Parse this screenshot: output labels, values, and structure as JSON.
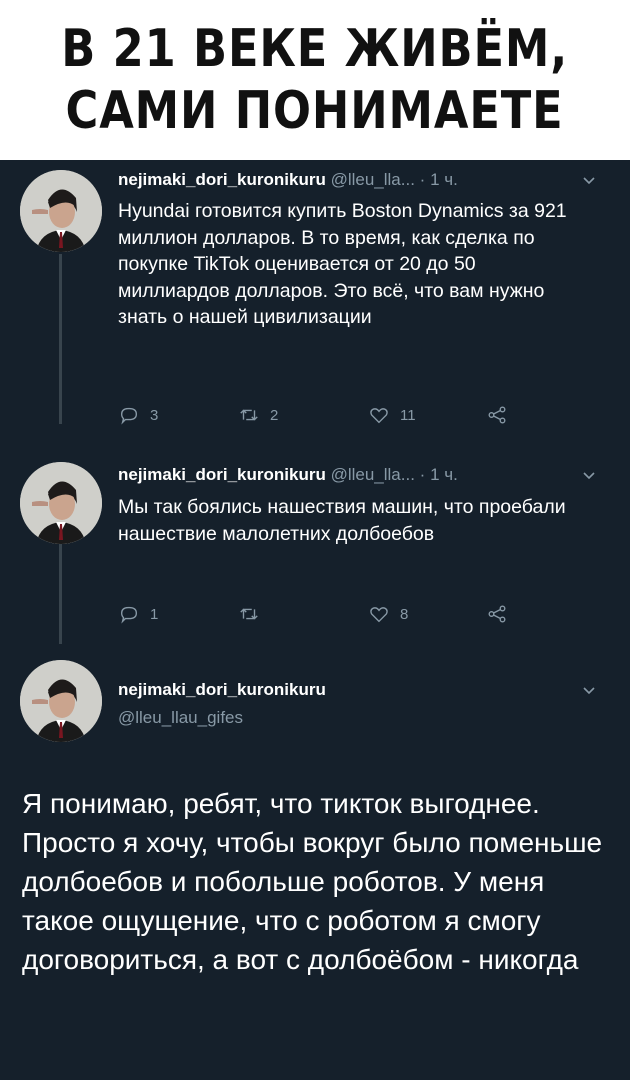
{
  "caption": {
    "line1": "В 21 ВЕКЕ ЖИВЁМ,",
    "line2": "САМИ ПОНИМАЕТЕ"
  },
  "colors": {
    "background": "#15202b",
    "text": "#ffffff",
    "muted": "#8899a6",
    "thread_line": "#38444d",
    "caption_bg": "#ffffff",
    "caption_text": "#111111"
  },
  "tweets": [
    {
      "name": "nejimaki_dori_kuronikuru",
      "handle": "@lleu_lla...",
      "dot": "·",
      "time": "1 ч.",
      "menu_icon": "chevron-down-icon",
      "text": "Hyundai готовится купить Boston Dynamics за 921 миллион долларов. В то время, как сделка по покупке TikTok оценивается от 20 до 50 миллиардов долларов. Это всё, что вам нужно знать о нашей цивилизации",
      "actions": {
        "reply_count": "3",
        "retweet_count": "2",
        "like_count": "11",
        "reply_icon": "reply-icon",
        "retweet_icon": "retweet-icon",
        "like_icon": "heart-icon",
        "share_icon": "share-icon"
      }
    },
    {
      "name": "nejimaki_dori_kuronikuru",
      "handle": "@lleu_lla...",
      "dot": "·",
      "time": "1 ч.",
      "menu_icon": "chevron-down-icon",
      "text": "Мы так боялись нашествия машин, что проебали нашествие малолетних долбоебов",
      "actions": {
        "reply_count": "1",
        "retweet_count": "",
        "like_count": "8",
        "reply_icon": "reply-icon",
        "retweet_icon": "retweet-icon",
        "like_icon": "heart-icon",
        "share_icon": "share-icon"
      }
    }
  ],
  "main_tweet": {
    "name": "nejimaki_dori_kuronikuru",
    "handle": "@lleu_llau_gifes",
    "menu_icon": "chevron-down-icon",
    "text": "Я понимаю, ребят, что тикток выгоднее. Просто я хочу, чтобы вокруг было поменьше долбоебов и побольше роботов. У меня такое ощущение, что с роботом я смогу договориться, а вот с долбоёбом - никогда"
  }
}
